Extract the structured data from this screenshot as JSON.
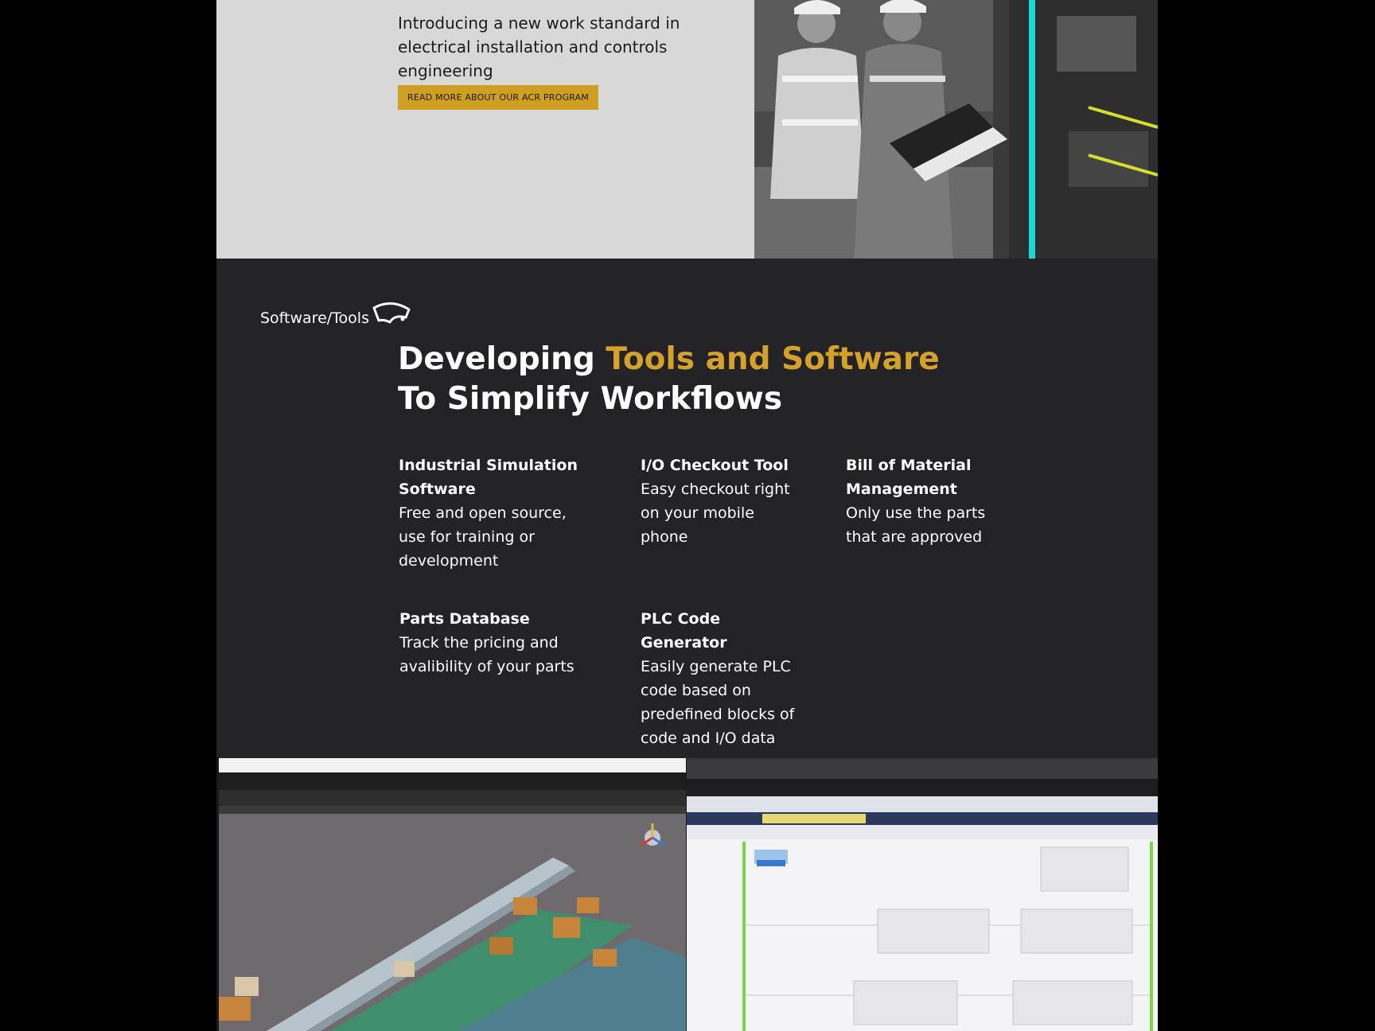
{
  "hero": {
    "intro": "Introducing a new work standard in electrical installation and controls engineering",
    "button_label": "READ MORE ABOUT OUR ACR PROGRAM"
  },
  "tools_section": {
    "breadcrumb": "Software/Tools",
    "headline_part1": "Developing ",
    "headline_accent": "Tools and Software",
    "headline_part2": "To Simplify Workflows",
    "features": [
      {
        "title": "Industrial Simulation Software",
        "desc": "Free and open source, use for training or development"
      },
      {
        "title": "I/O Checkout Tool",
        "desc": "Easy checkout right on your mobile phone"
      },
      {
        "title": "Bill of Material Management",
        "desc": "Only use the parts that are approved"
      },
      {
        "title": "Parts Database",
        "desc": "Track the pricing and avalibility of your parts"
      },
      {
        "title": "PLC Code Generator",
        "desc": "Easily generate PLC code based on predefined blocks of code and I/O data"
      }
    ]
  },
  "colors": {
    "accent": "#d4a22a",
    "button_bg": "#cf9f22",
    "dark_bg": "#232327",
    "hero_bg": "#d8d8d9"
  }
}
